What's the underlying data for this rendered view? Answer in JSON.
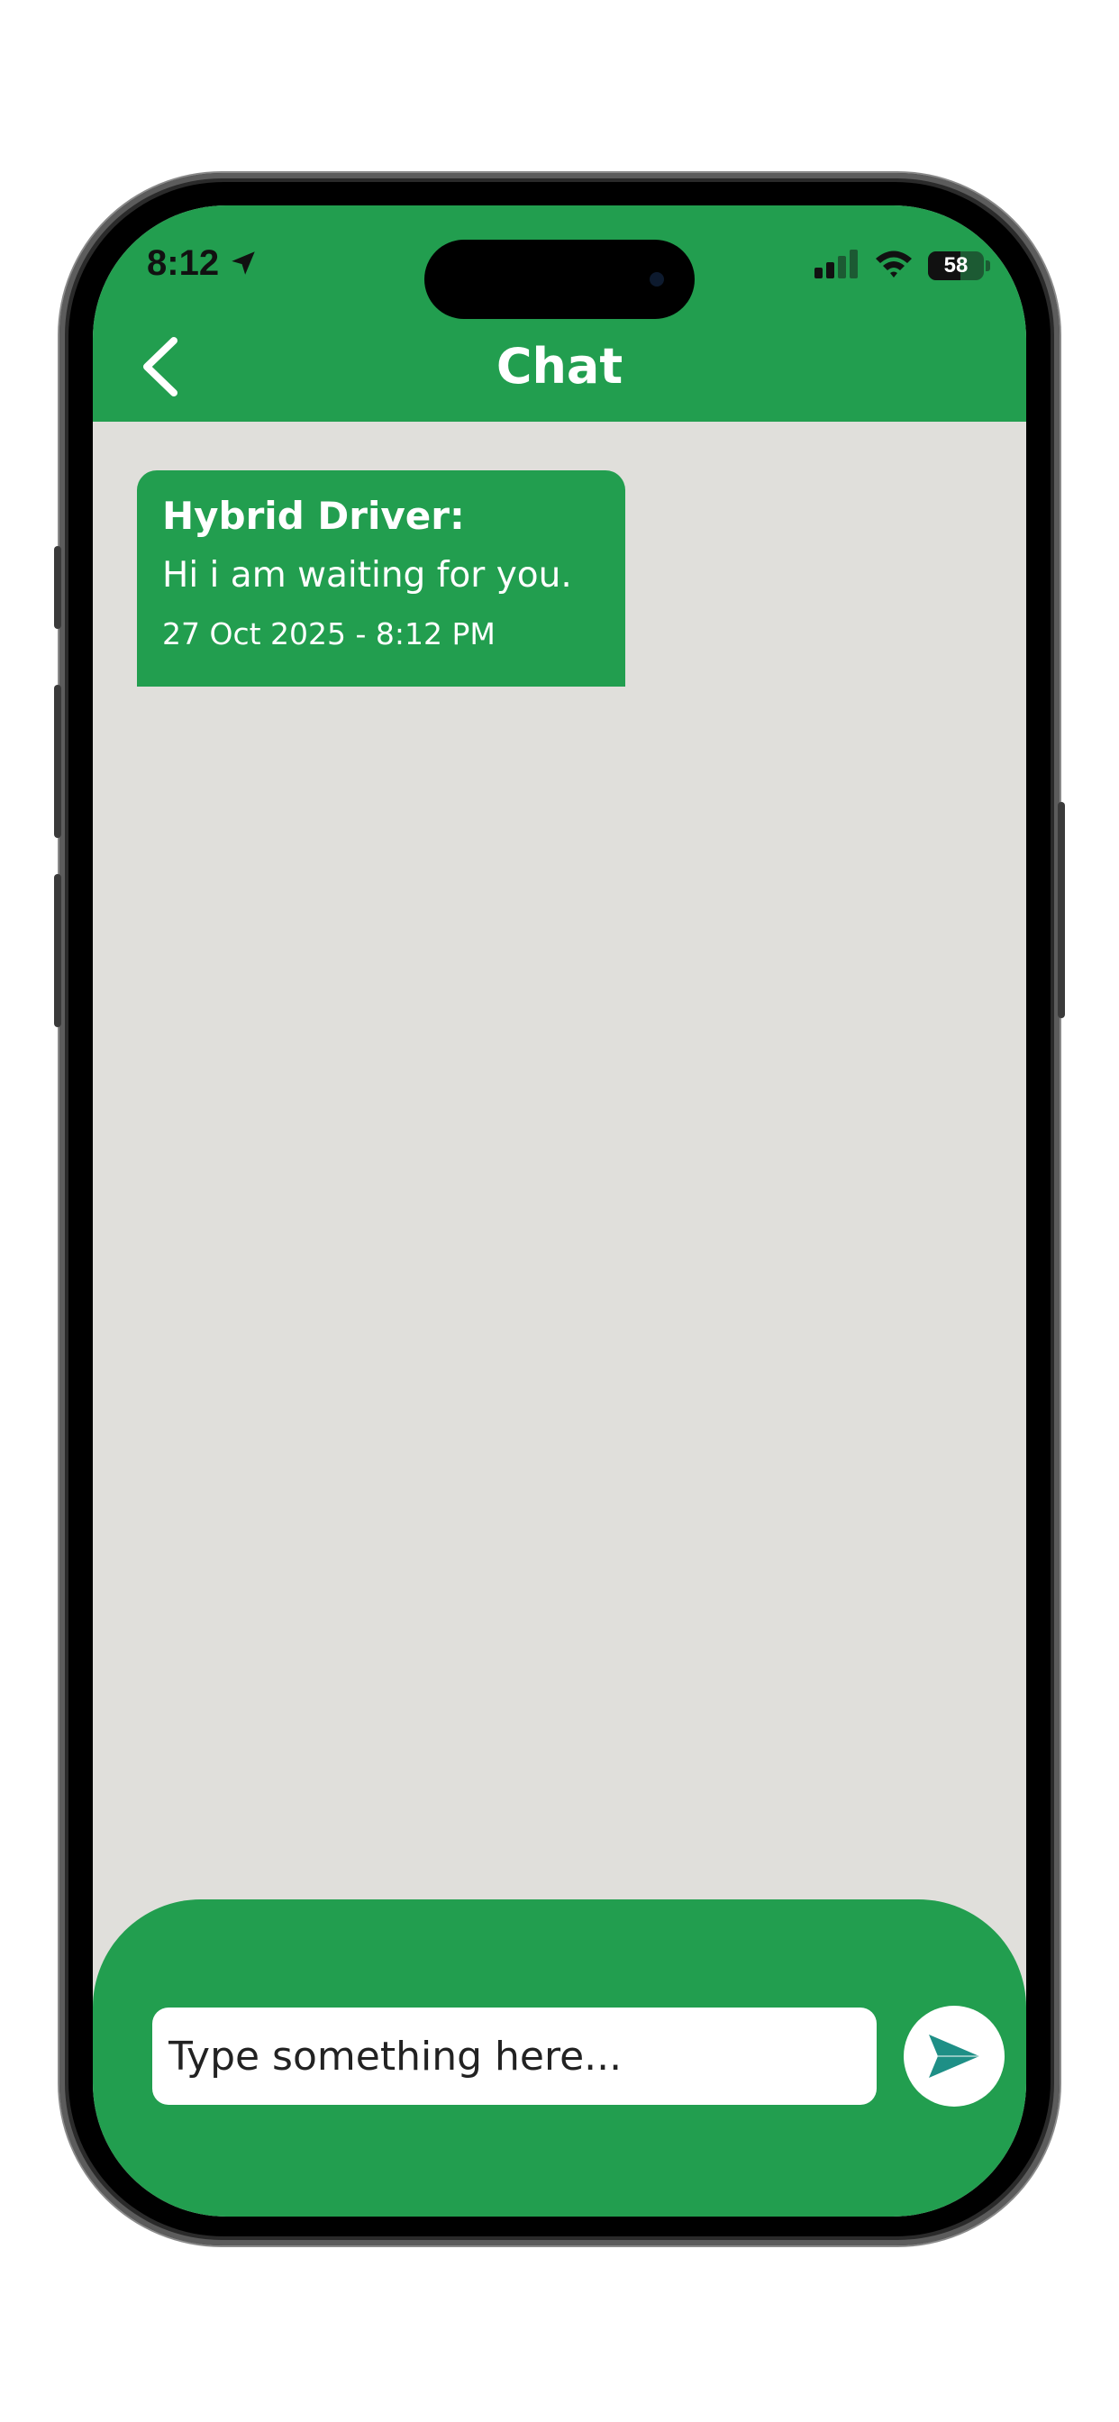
{
  "status_bar": {
    "time": "8:12",
    "location_icon": "location-arrow-icon",
    "signal_icon": "cellular-signal-icon",
    "wifi_icon": "wifi-icon",
    "battery_level": "58",
    "battery_fraction": 0.58
  },
  "header": {
    "title": "Chat",
    "back_icon": "chevron-left-icon"
  },
  "messages": [
    {
      "sender": "Hybrid Driver:",
      "text": "Hi i am waiting for you.",
      "timestamp": "27 Oct 2025 - 8:12 PM"
    }
  ],
  "composer": {
    "placeholder": "Type something here...",
    "value": "",
    "send_icon": "send-arrow-icon"
  },
  "colors": {
    "brand_green": "#229e4f",
    "chat_background": "#e0dfdb",
    "send_icon_teal": "#1e8f86"
  }
}
